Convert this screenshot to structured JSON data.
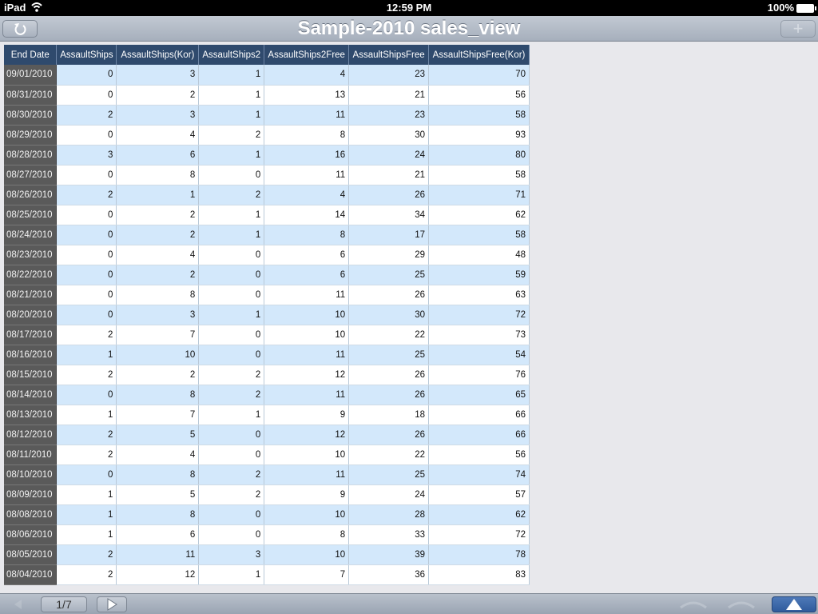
{
  "status": {
    "device": "iPad",
    "time": "12:59 PM",
    "battery": "100%"
  },
  "nav": {
    "title": "Sample-2010 sales_view",
    "add_icon": "plus-icon",
    "back_icon": "refresh-back-icon"
  },
  "table": {
    "columns": [
      "End Date",
      "AssaultShips",
      "AssaultShips(Kor)",
      "AssaultShips2",
      "AssaultShips2Free",
      "AssaultShipsFree",
      "AssaultShipsFree(Kor)"
    ],
    "rows": [
      [
        "09/01/2010",
        "0",
        "3",
        "1",
        "4",
        "23",
        "70"
      ],
      [
        "08/31/2010",
        "0",
        "2",
        "1",
        "13",
        "21",
        "56"
      ],
      [
        "08/30/2010",
        "2",
        "3",
        "1",
        "11",
        "23",
        "58"
      ],
      [
        "08/29/2010",
        "0",
        "4",
        "2",
        "8",
        "30",
        "93"
      ],
      [
        "08/28/2010",
        "3",
        "6",
        "1",
        "16",
        "24",
        "80"
      ],
      [
        "08/27/2010",
        "0",
        "8",
        "0",
        "11",
        "21",
        "58"
      ],
      [
        "08/26/2010",
        "2",
        "1",
        "2",
        "4",
        "26",
        "71"
      ],
      [
        "08/25/2010",
        "0",
        "2",
        "1",
        "14",
        "34",
        "62"
      ],
      [
        "08/24/2010",
        "0",
        "2",
        "1",
        "8",
        "17",
        "58"
      ],
      [
        "08/23/2010",
        "0",
        "4",
        "0",
        "6",
        "29",
        "48"
      ],
      [
        "08/22/2010",
        "0",
        "2",
        "0",
        "6",
        "25",
        "59"
      ],
      [
        "08/21/2010",
        "0",
        "8",
        "0",
        "11",
        "26",
        "63"
      ],
      [
        "08/20/2010",
        "0",
        "3",
        "1",
        "10",
        "30",
        "72"
      ],
      [
        "08/17/2010",
        "2",
        "7",
        "0",
        "10",
        "22",
        "73"
      ],
      [
        "08/16/2010",
        "1",
        "10",
        "0",
        "11",
        "25",
        "54"
      ],
      [
        "08/15/2010",
        "2",
        "2",
        "2",
        "12",
        "26",
        "76"
      ],
      [
        "08/14/2010",
        "0",
        "8",
        "2",
        "11",
        "26",
        "65"
      ],
      [
        "08/13/2010",
        "1",
        "7",
        "1",
        "9",
        "18",
        "66"
      ],
      [
        "08/12/2010",
        "2",
        "5",
        "0",
        "12",
        "26",
        "66"
      ],
      [
        "08/11/2010",
        "2",
        "4",
        "0",
        "10",
        "22",
        "56"
      ],
      [
        "08/10/2010",
        "0",
        "8",
        "2",
        "11",
        "25",
        "74"
      ],
      [
        "08/09/2010",
        "1",
        "5",
        "2",
        "9",
        "24",
        "57"
      ],
      [
        "08/08/2010",
        "1",
        "8",
        "0",
        "10",
        "28",
        "62"
      ],
      [
        "08/06/2010",
        "1",
        "6",
        "0",
        "8",
        "33",
        "72"
      ],
      [
        "08/05/2010",
        "2",
        "11",
        "3",
        "10",
        "39",
        "78"
      ],
      [
        "08/04/2010",
        "2",
        "12",
        "1",
        "7",
        "36",
        "83"
      ]
    ]
  },
  "toolbar": {
    "page_indicator": "1/7",
    "prev_icon": "arrow-left-icon",
    "next_icon": "play-right-icon",
    "up_icon": "triangle-up-icon"
  },
  "colors": {
    "header_bg": "#2f4a6d",
    "date_col_bg": "#5a5a5a",
    "row_alt_bg": "#d3e8fb",
    "row_bg": "#ffffff"
  }
}
